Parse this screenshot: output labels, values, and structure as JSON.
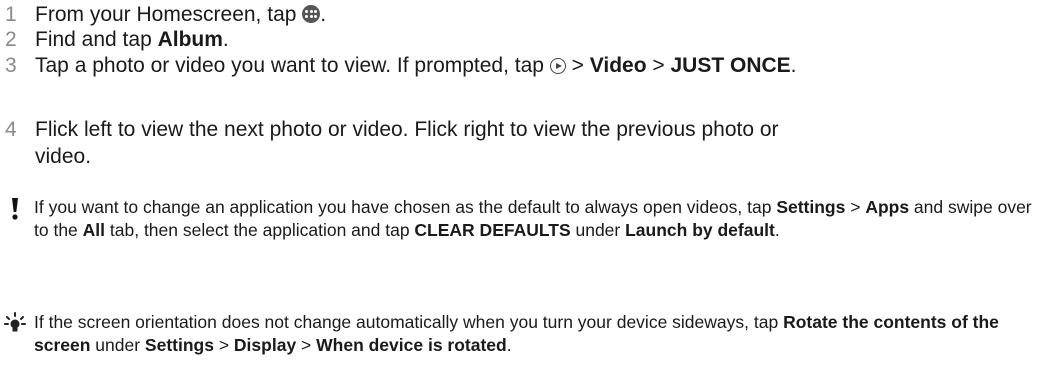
{
  "steps": [
    {
      "num": "1",
      "t1": "From your Homescreen, tap ",
      "t2": "."
    },
    {
      "num": "2",
      "t1": "Find and tap ",
      "b1": "Album",
      "t2": "."
    },
    {
      "num": "3",
      "t1": "Tap a photo or video you want to view. If prompted, tap ",
      "t2": " > ",
      "b1": "Video",
      "t3": " > ",
      "b2": "JUST ONCE",
      "t4": "."
    },
    {
      "num": "4",
      "t1": "Flick left to view the next photo or video. Flick right to view the previous photo or video."
    }
  ],
  "note_warning": {
    "t1": "If you want to change an application you have chosen as the default to always open videos, tap ",
    "b1": "Settings",
    "t2": " > ",
    "b2": "Apps",
    "t3": " and swipe over to the ",
    "b3": "All",
    "t4": " tab, then select the application and tap ",
    "b4": "CLEAR DEFAULTS",
    "t5": " under ",
    "b5": "Launch by default",
    "t6": "."
  },
  "note_tip": {
    "t1": "If the screen orientation does not change automatically when you turn your device sideways, tap ",
    "b1": "Rotate the contents of the screen",
    "t2": " under ",
    "b2": "Settings",
    "t3": " > ",
    "b3": "Display",
    "t4": " > ",
    "b4": "When device is rotated",
    "t5": "."
  },
  "icons": {
    "step1": "apps-menu-icon",
    "step3": "play-icon",
    "warning": "exclamation-icon",
    "tip": "lightbulb-icon"
  }
}
